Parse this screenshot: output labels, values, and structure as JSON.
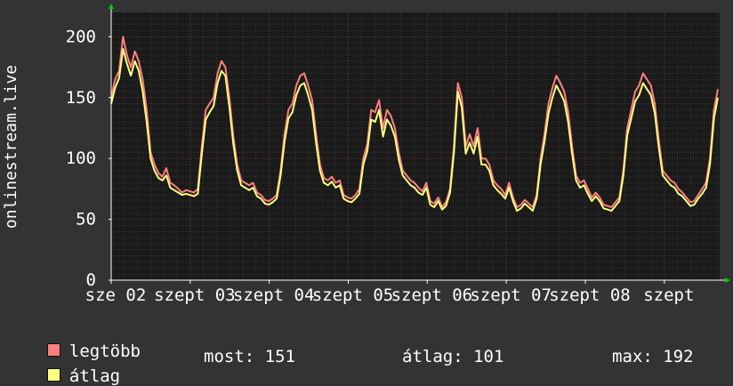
{
  "chart_data": {
    "type": "line",
    "ylabel": "onlinestream.live",
    "ylim": [
      0,
      220
    ],
    "y_ticks": [
      0,
      50,
      100,
      150,
      200
    ],
    "x_tick_labels": [
      "sze 02",
      "szept 03",
      "szept 04",
      "szept 05",
      "szept 06",
      "szept 07",
      "szept 08",
      "szept"
    ],
    "series": [
      {
        "name": "legtöbb",
        "color": "#ff7f80",
        "values": [
          150,
          165,
          172,
          200,
          185,
          175,
          188,
          180,
          165,
          140,
          105,
          95,
          88,
          85,
          92,
          80,
          78,
          75,
          72,
          74,
          73,
          72,
          75,
          110,
          140,
          145,
          150,
          170,
          180,
          175,
          150,
          118,
          95,
          82,
          80,
          78,
          80,
          72,
          70,
          66,
          65,
          67,
          70,
          90,
          120,
          140,
          145,
          160,
          168,
          170,
          160,
          148,
          120,
          95,
          84,
          82,
          85,
          80,
          82,
          70,
          68,
          67,
          70,
          75,
          100,
          112,
          140,
          138,
          148,
          125,
          140,
          135,
          125,
          105,
          90,
          86,
          82,
          80,
          76,
          73,
          80,
          65,
          63,
          68,
          60,
          64,
          75,
          110,
          162,
          150,
          110,
          120,
          110,
          125,
          100,
          100,
          95,
          82,
          78,
          75,
          70,
          80,
          68,
          60,
          62,
          66,
          63,
          60,
          70,
          100,
          120,
          145,
          158,
          168,
          162,
          155,
          138,
          110,
          86,
          80,
          82,
          75,
          68,
          72,
          68,
          62,
          61,
          60,
          64,
          68,
          90,
          125,
          140,
          155,
          160,
          170,
          165,
          160,
          145,
          115,
          90,
          86,
          82,
          80,
          75,
          72,
          68,
          64,
          65,
          70,
          75,
          80,
          100,
          140,
          157
        ]
      },
      {
        "name": "átlag",
        "color": "#ffff80",
        "values": [
          145,
          158,
          166,
          190,
          178,
          168,
          180,
          172,
          155,
          130,
          100,
          90,
          84,
          82,
          86,
          76,
          74,
          72,
          70,
          71,
          70,
          69,
          71,
          104,
          132,
          138,
          143,
          162,
          172,
          168,
          142,
          112,
          90,
          78,
          76,
          74,
          76,
          69,
          67,
          63,
          62,
          64,
          67,
          86,
          114,
          133,
          138,
          152,
          160,
          162,
          152,
          140,
          113,
          90,
          80,
          78,
          81,
          76,
          78,
          67,
          65,
          64,
          67,
          71,
          95,
          106,
          132,
          130,
          140,
          118,
          132,
          127,
          118,
          99,
          86,
          82,
          78,
          76,
          72,
          70,
          76,
          62,
          60,
          65,
          58,
          61,
          72,
          105,
          155,
          142,
          104,
          113,
          104,
          118,
          95,
          95,
          90,
          78,
          74,
          71,
          67,
          76,
          65,
          57,
          59,
          63,
          60,
          57,
          67,
          95,
          114,
          137,
          150,
          160,
          154,
          147,
          130,
          104,
          82,
          76,
          78,
          71,
          65,
          69,
          65,
          59,
          58,
          57,
          61,
          65,
          86,
          119,
          133,
          147,
          152,
          162,
          157,
          152,
          137,
          109,
          86,
          82,
          78,
          76,
          71,
          69,
          65,
          61,
          62,
          67,
          71,
          76,
          95,
          133,
          150
        ]
      }
    ]
  },
  "legend": {
    "max_label": "legtöbb",
    "avg_label": "átlag",
    "max_color": "#ff7f80",
    "avg_color": "#ffff80"
  },
  "stats": {
    "now": "most: 151",
    "avg": "átlag: 101",
    "max": "max: 192"
  }
}
